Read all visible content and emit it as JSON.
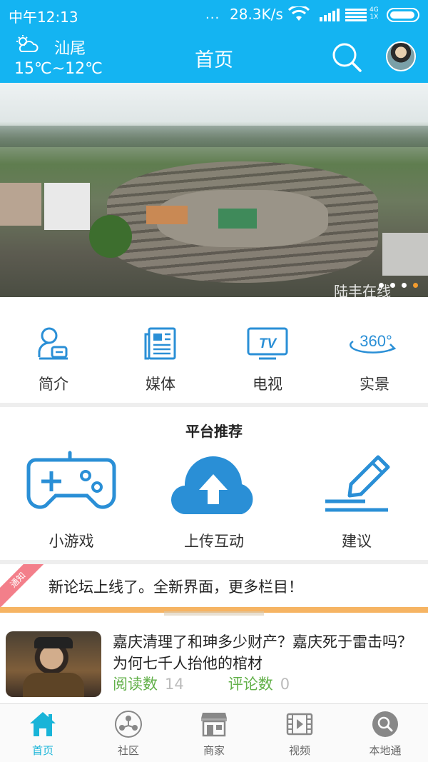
{
  "status_bar": {
    "time": "中午12:13",
    "dots": "...",
    "speed": "28.3K/s",
    "net_type": "4G",
    "sim": "1X"
  },
  "header": {
    "city": "汕尾",
    "temperature": "15℃~12℃",
    "title": "首页"
  },
  "banner": {
    "watermark": "陆丰在线",
    "slides": 4,
    "active_slide": 4
  },
  "categories": [
    {
      "label": "简介",
      "icon": "profile-icon"
    },
    {
      "label": "媒体",
      "icon": "newspaper-icon"
    },
    {
      "label": "电视",
      "icon": "tv-icon",
      "icon_text": "TV"
    },
    {
      "label": "实景",
      "icon": "panorama-360-icon",
      "icon_text": "360°"
    }
  ],
  "recommend": {
    "title": "平台推荐",
    "items": [
      {
        "label": "小游戏",
        "icon": "gamepad-icon"
      },
      {
        "label": "上传互动",
        "icon": "cloud-upload-icon"
      },
      {
        "label": "建议",
        "icon": "pencil-icon"
      }
    ]
  },
  "notice": {
    "tag": "通知",
    "text": "新论坛上线了。全新界面，更多栏目！"
  },
  "article": {
    "title": "嘉庆清理了和珅多少财产？嘉庆死于雷击吗？为何七千人抬他的棺材",
    "reads_label": "阅读数",
    "reads": "14",
    "comments_label": "评论数",
    "comments": "0"
  },
  "tabs": [
    {
      "label": "首页",
      "icon": "home-icon",
      "active": true
    },
    {
      "label": "社区",
      "icon": "community-icon",
      "active": false
    },
    {
      "label": "商家",
      "icon": "store-icon",
      "active": false
    },
    {
      "label": "视频",
      "icon": "video-icon",
      "active": false
    },
    {
      "label": "本地通",
      "icon": "local-search-icon",
      "active": false
    }
  ],
  "colors": {
    "primary": "#14b4f2",
    "icon_blue": "#2a8fd6",
    "notice_orange": "#f6b463",
    "meta_green": "#62b049",
    "tab_active": "#18b4d8"
  }
}
